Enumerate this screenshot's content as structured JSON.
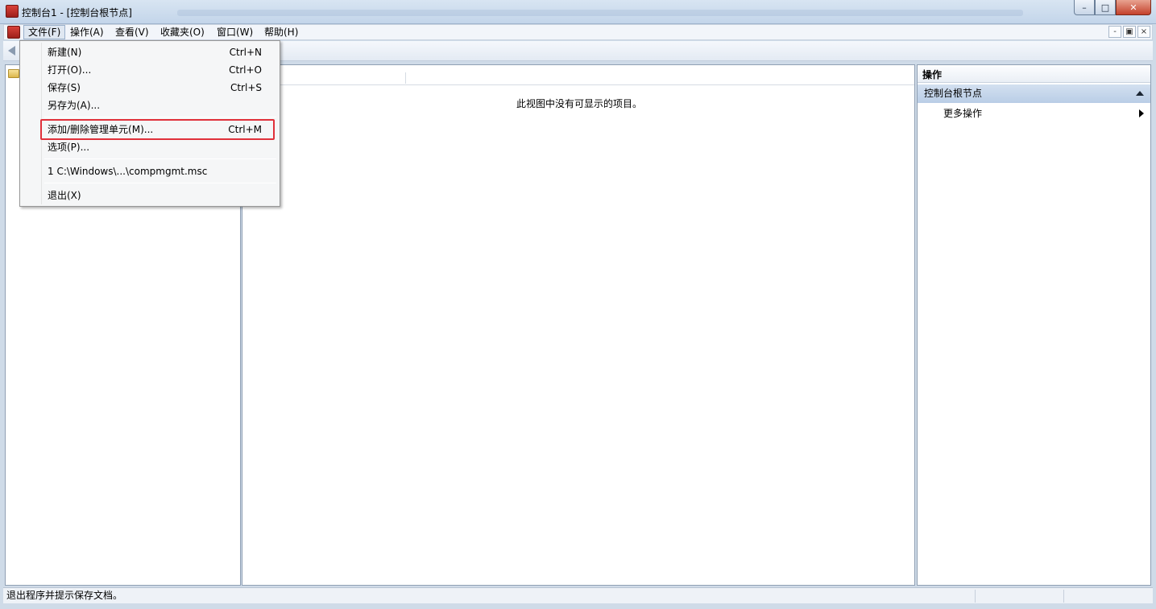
{
  "window": {
    "title": "控制台1 - [控制台根节点]",
    "min_label": "–",
    "max_label": "□",
    "close_label": "✕"
  },
  "menubar": {
    "items": [
      "文件(F)",
      "操作(A)",
      "查看(V)",
      "收藏夹(O)",
      "窗口(W)",
      "帮助(H)"
    ],
    "mdi_min": "-",
    "mdi_restore": "▣",
    "mdi_close": "×"
  },
  "file_menu": {
    "items": [
      {
        "label": "新建(N)",
        "shortcut": "Ctrl+N"
      },
      {
        "label": "打开(O)...",
        "shortcut": "Ctrl+O"
      },
      {
        "label": "保存(S)",
        "shortcut": "Ctrl+S"
      },
      {
        "label": "另存为(A)...",
        "shortcut": ""
      },
      {
        "label": "添加/删除管理单元(M)...",
        "shortcut": "Ctrl+M"
      },
      {
        "label": "选项(P)...",
        "shortcut": ""
      },
      {
        "label": "1 C:\\Windows\\...\\compmgmt.msc",
        "shortcut": ""
      },
      {
        "label": "退出(X)",
        "shortcut": ""
      }
    ],
    "highlighted_item": "添加/删除管理单元(M)...",
    "highlight_color": "#e0303a"
  },
  "center": {
    "empty_message": "此视图中没有可显示的项目。"
  },
  "actions_pane": {
    "header": "操作",
    "section": "控制台根节点",
    "items": [
      "更多操作"
    ]
  },
  "statusbar": {
    "text": "退出程序并提示保存文档。"
  },
  "icons": {
    "app": "mmc-console-icon",
    "back": "back-arrow-icon",
    "folder": "folder-icon",
    "collapse": "collapse-up-icon",
    "submenu": "submenu-arrow-icon"
  }
}
